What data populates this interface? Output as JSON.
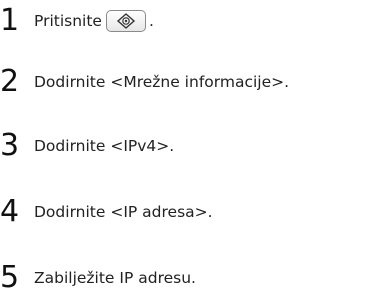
{
  "steps": [
    {
      "number": "1",
      "text": "Pritisnite",
      "suffix": ".",
      "button_icon": "settings-key-icon"
    },
    {
      "number": "2",
      "text": "Dodirnite <Mrežne informacije>."
    },
    {
      "number": "3",
      "text": "Dodirnite <IPv4>."
    },
    {
      "number": "4",
      "text": "Dodirnite <IP adresa>."
    },
    {
      "number": "5",
      "text": "Zabilježite IP adresu."
    }
  ]
}
